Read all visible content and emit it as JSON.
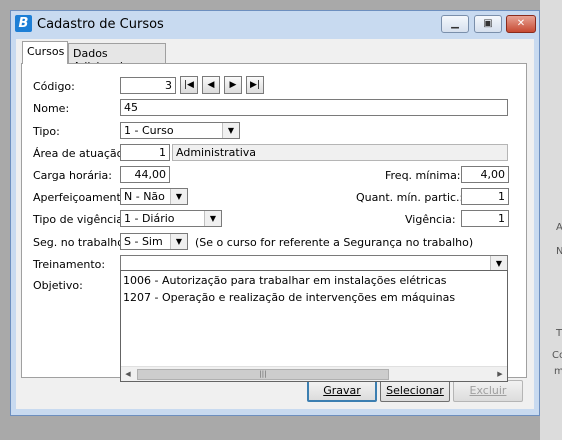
{
  "window": {
    "title": "Cadastro de Cursos",
    "app_icon": "B"
  },
  "tabs": [
    {
      "label": "Cursos"
    },
    {
      "label": "Dados Adicionais"
    }
  ],
  "form": {
    "codigo": {
      "label": "Código:",
      "value": "3"
    },
    "nome": {
      "label": "Nome:",
      "value": "45"
    },
    "tipo": {
      "label": "Tipo:",
      "value": "1 - Curso"
    },
    "area": {
      "label": "Área de atuação:",
      "code": "1",
      "desc": "Administrativa"
    },
    "carga": {
      "label": "Carga horária:",
      "value": "44,00"
    },
    "freq": {
      "label": "Freq. mínima:",
      "value": "4,00"
    },
    "aperf": {
      "label": "Aperfeiçoamento:",
      "value": "N - Não"
    },
    "quant": {
      "label": "Quant. mín. partic.:",
      "value": "1"
    },
    "tipo_vig": {
      "label": "Tipo de vigência:",
      "value": "1 - Diário"
    },
    "vigencia": {
      "label": "Vigência:",
      "value": "1"
    },
    "seg": {
      "label": "Seg. no trabalho:",
      "value": "S - Sim",
      "note": "(Se o curso for referente a Segurança no trabalho)"
    },
    "treinamento": {
      "label": "Treinamento:",
      "value": ""
    },
    "objetivo": {
      "label": "Objetivo:"
    }
  },
  "dropdown_items": [
    "1006 - Autorização para trabalhar em instalações elétricas",
    "1207 - Operação e realização de intervenções em máquinas"
  ],
  "buttons": {
    "gravar": "Gravar",
    "selecionar": "Selecionar",
    "excluir": "Excluir"
  },
  "background": {
    "a": "A",
    "n": "N",
    "t": "T",
    "co": "Co",
    "m": "m"
  }
}
